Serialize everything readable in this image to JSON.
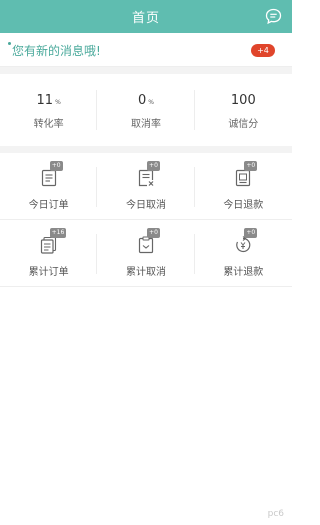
{
  "header": {
    "title": "首页",
    "message_icon": "chat-bubble-icon"
  },
  "notice": {
    "text": "您有新的消息哦!",
    "badge": "+4"
  },
  "stats": [
    {
      "value": "11",
      "unit": "%",
      "label": "转化率"
    },
    {
      "value": "0",
      "unit": "%",
      "label": "取消率"
    },
    {
      "value": "100",
      "unit": "",
      "label": "诚信分"
    }
  ],
  "today": [
    {
      "label": "今日订单",
      "count": "+0",
      "icon": "order-list-icon"
    },
    {
      "label": "今日取消",
      "count": "+0",
      "icon": "cancel-order-icon"
    },
    {
      "label": "今日退款",
      "count": "+0",
      "icon": "refund-icon"
    }
  ],
  "total": [
    {
      "label": "累计订单",
      "count": "+16",
      "icon": "stacked-orders-icon"
    },
    {
      "label": "累计取消",
      "count": "+0",
      "icon": "clipboard-cancel-icon"
    },
    {
      "label": "累计退款",
      "count": "+0",
      "icon": "money-refund-icon"
    }
  ],
  "watermark": "pc6",
  "colors": {
    "accent": "#5fbdb0",
    "badge": "#e0452b",
    "notice_text": "#49a99b"
  }
}
